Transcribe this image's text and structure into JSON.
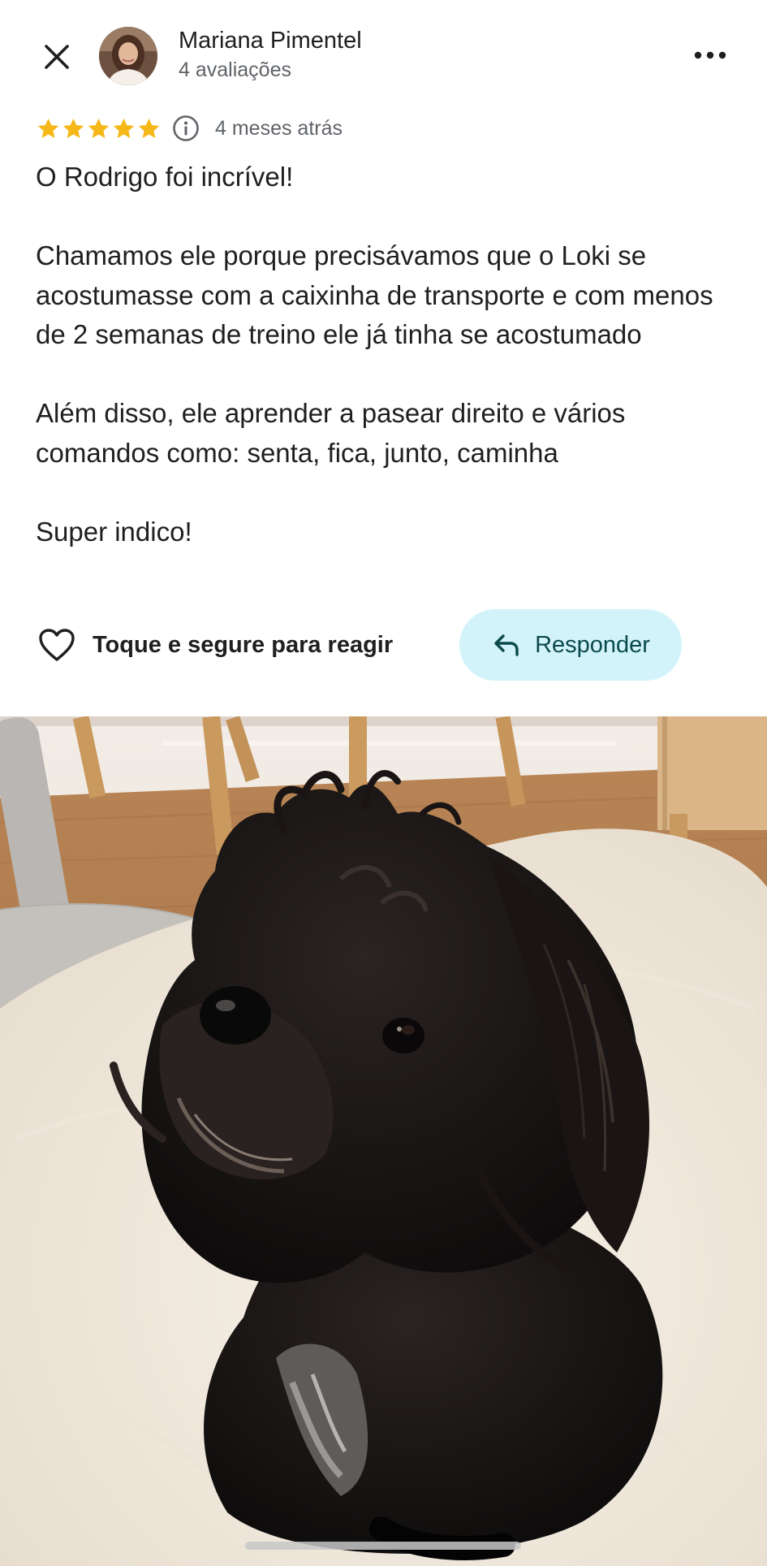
{
  "header": {
    "close_icon": "close-icon",
    "reviewer_name": "Mariana Pimentel",
    "review_count": "4 avaliações",
    "more_icon": "more-horizontal-icon"
  },
  "review": {
    "rating": 5,
    "rating_max": 5,
    "star_color": "#f6b818",
    "info_icon": "info-icon",
    "time_ago": "4 meses atrás",
    "paragraphs": [
      "O Rodrigo foi incrível!",
      "Chamamos ele porque precisávamos que o Loki se acostumasse com a caixinha de transporte e com menos de 2 semanas de treino ele já tinha se acostumado",
      "Além disso, ele aprender a pasear direito e vários comandos como: senta, fica, junto, caminha",
      "Super indico!"
    ]
  },
  "actions": {
    "react_label": "Toque e segure para reagir",
    "react_icon": "heart-outline-icon",
    "reply_label": "Responder",
    "reply_icon": "reply-arrow-icon",
    "reply_bg": "#d3f3fb"
  }
}
